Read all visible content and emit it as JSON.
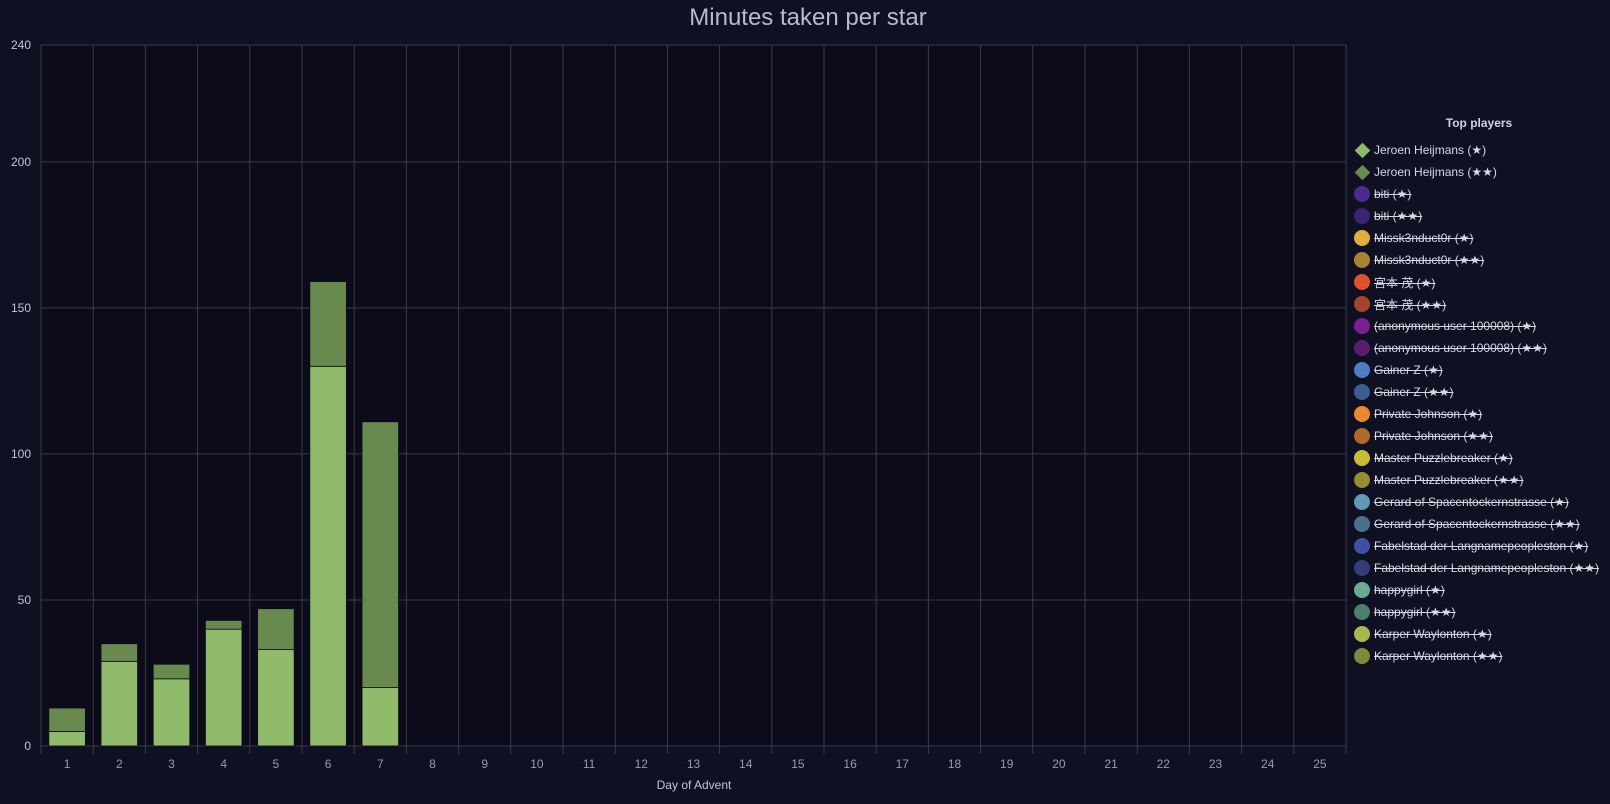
{
  "chart_data": {
    "type": "bar",
    "title": "Minutes taken per star",
    "xlabel": "Day of Advent",
    "ylabel": "",
    "categories": [
      "1",
      "2",
      "3",
      "4",
      "5",
      "6",
      "7",
      "8",
      "9",
      "10",
      "11",
      "12",
      "13",
      "14",
      "15",
      "16",
      "17",
      "18",
      "19",
      "20",
      "21",
      "22",
      "23",
      "24",
      "25"
    ],
    "ylim": [
      0,
      240
    ],
    "yticks": [
      0,
      50,
      100,
      150,
      200,
      240
    ],
    "stacked": true,
    "grid": true,
    "legend_position": "right",
    "series": [
      {
        "name": "Jeroen Heijmans (★)",
        "color": "#8fbb6a",
        "values": [
          5,
          29,
          23,
          40,
          33,
          130,
          20,
          null,
          null,
          null,
          null,
          null,
          null,
          null,
          null,
          null,
          null,
          null,
          null,
          null,
          null,
          null,
          null,
          null,
          null
        ]
      },
      {
        "name": "Jeroen Heijmans (★★)",
        "color": "#688a4e",
        "values": [
          8,
          6,
          5,
          3,
          14,
          29,
          91,
          null,
          null,
          null,
          null,
          null,
          null,
          null,
          null,
          null,
          null,
          null,
          null,
          null,
          null,
          null,
          null,
          null,
          null
        ]
      }
    ]
  },
  "legend": {
    "title": "Top players",
    "items": [
      {
        "label": "Jeroen Heijmans (★)",
        "color": "#8fbb6a",
        "shape": "diamond",
        "hidden": false
      },
      {
        "label": "Jeroen Heijmans (★★)",
        "color": "#688a4e",
        "shape": "diamond",
        "hidden": false
      },
      {
        "label": "biti (★)",
        "color": "#4b2a92",
        "shape": "circle",
        "hidden": true
      },
      {
        "label": "biti (★★)",
        "color": "#3a2472",
        "shape": "circle",
        "hidden": true
      },
      {
        "label": "Missk3nduct0r (★)",
        "color": "#e0ac3a",
        "shape": "circle",
        "hidden": true
      },
      {
        "label": "Missk3nduct0r (★★)",
        "color": "#a8822f",
        "shape": "circle",
        "hidden": true
      },
      {
        "label": "宮本 茂 (★)",
        "color": "#e0522a",
        "shape": "circle",
        "hidden": true
      },
      {
        "label": "宮本 茂 (★★)",
        "color": "#a8422a",
        "shape": "circle",
        "hidden": true
      },
      {
        "label": "(anonymous user 100008) (★)",
        "color": "#7a1f92",
        "shape": "circle",
        "hidden": true
      },
      {
        "label": "(anonymous user 100008) (★★)",
        "color": "#5c1d6e",
        "shape": "circle",
        "hidden": true
      },
      {
        "label": "Gainer Z (★)",
        "color": "#4f7ec2",
        "shape": "circle",
        "hidden": true
      },
      {
        "label": "Gainer Z (★★)",
        "color": "#3b5c92",
        "shape": "circle",
        "hidden": true
      },
      {
        "label": "Private Johnson (★)",
        "color": "#e88a2a",
        "shape": "circle",
        "hidden": true
      },
      {
        "label": "Private Johnson (★★)",
        "color": "#ad682a",
        "shape": "circle",
        "hidden": true
      },
      {
        "label": "Master Puzzlebreaker (★)",
        "color": "#c7bb32",
        "shape": "circle",
        "hidden": true
      },
      {
        "label": "Master Puzzlebreaker (★★)",
        "color": "#968d2e",
        "shape": "circle",
        "hidden": true
      },
      {
        "label": "Gerard of Spacentockernstrasse (★)",
        "color": "#5e9ab5",
        "shape": "circle",
        "hidden": true
      },
      {
        "label": "Gerard of Spacentockernstrasse (★★)",
        "color": "#46728a",
        "shape": "circle",
        "hidden": true
      },
      {
        "label": "Fabelstad der Langnamepeopleston (★)",
        "color": "#4150a0",
        "shape": "circle",
        "hidden": true
      },
      {
        "label": "Fabelstad der Langnamepeopleston (★★)",
        "color": "#323d7a",
        "shape": "circle",
        "hidden": true
      },
      {
        "label": "happygirl (★)",
        "color": "#6aaa90",
        "shape": "circle",
        "hidden": true
      },
      {
        "label": "happygirl (★★)",
        "color": "#4e7f6c",
        "shape": "circle",
        "hidden": true
      },
      {
        "label": "Karper Waylonton (★)",
        "color": "#a9b84a",
        "shape": "circle",
        "hidden": true
      },
      {
        "label": "Karper Waylonton (★★)",
        "color": "#7f8a38",
        "shape": "circle",
        "hidden": true
      }
    ]
  },
  "colors": {
    "background": "#0f1022",
    "plot_background": "#0b0b19",
    "grid": "#3a3b4a"
  }
}
